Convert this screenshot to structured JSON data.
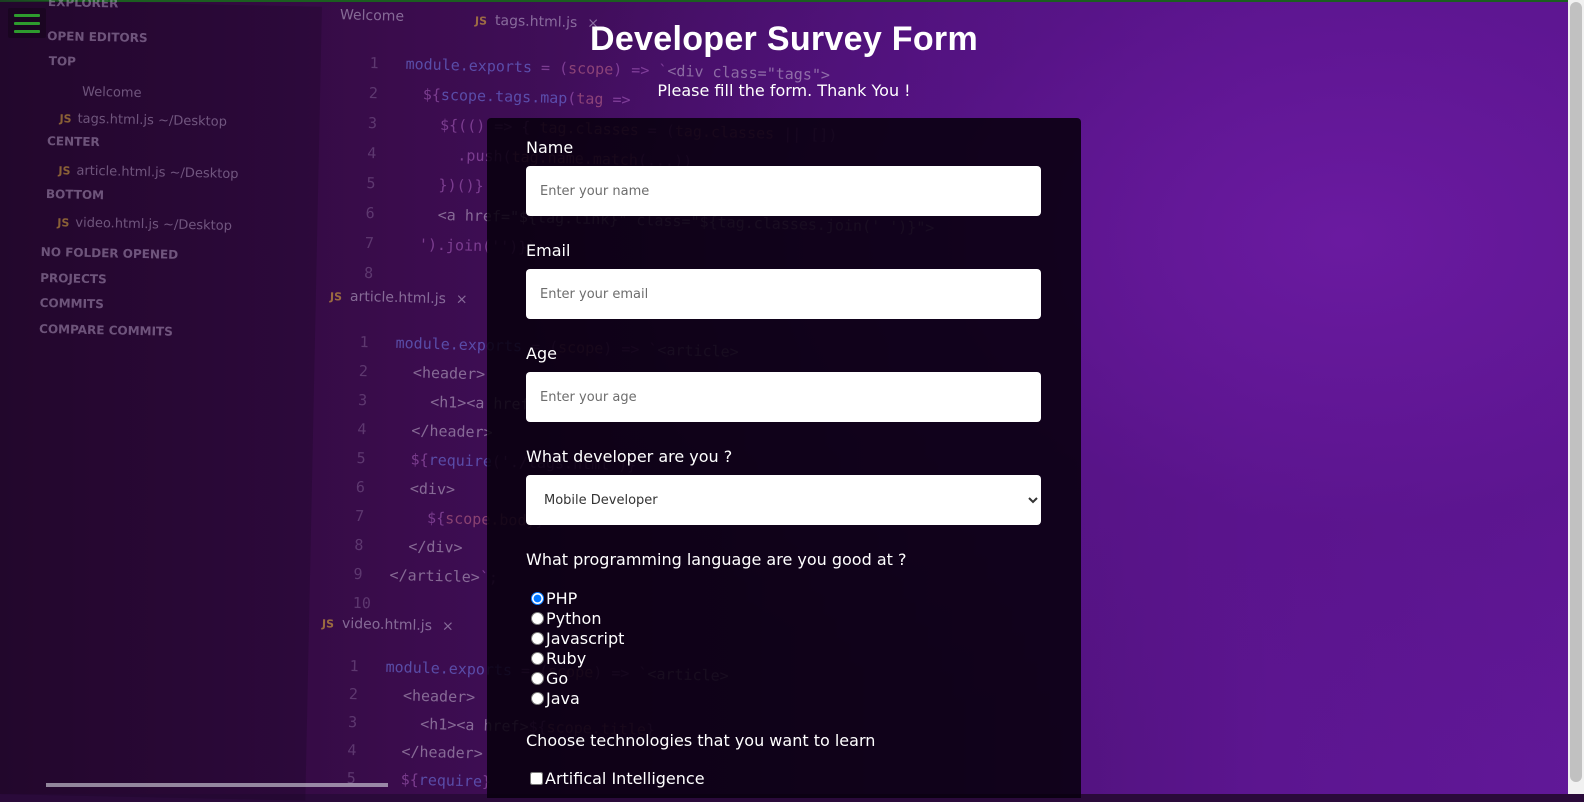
{
  "page": {
    "title": "Developer Survey Form",
    "subtitle": "Please fill the form. Thank You !"
  },
  "background": {
    "sidebar": {
      "explorer": "EXPLORER",
      "open_editors": "OPEN EDITORS",
      "top": "TOP",
      "welcome": "Welcome",
      "tags_file": "tags.html.js",
      "tags_path": "~/Desktop",
      "center": "CENTER",
      "article_file": "article.html.js",
      "article_path": "~/Desktop",
      "bottom": "BOTTOM",
      "video_file": "video.html.js",
      "video_path": "~/Desktop",
      "no_folder": "NO FOLDER OPENED",
      "projects": "PROJECTS",
      "commits": "COMMITS",
      "compare_commits": "COMPARE COMMITS",
      "js_tag": "JS"
    },
    "tabs": {
      "welcome": "Welcome",
      "tags": "tags.html.js",
      "article": "article.html.js",
      "video": "video.html.js",
      "close": "×"
    }
  },
  "form": {
    "name": {
      "label": "Name",
      "placeholder": "Enter your name"
    },
    "email": {
      "label": "Email",
      "placeholder": "Enter your email"
    },
    "age": {
      "label": "Age",
      "placeholder": "Enter your age"
    },
    "developer": {
      "label": "What developer are you ?",
      "selected": "Mobile Developer"
    },
    "language": {
      "label": "What programming language are you good at ?",
      "options": [
        "PHP",
        "Python",
        "Javascript",
        "Ruby",
        "Go",
        "Java"
      ],
      "selected": "PHP"
    },
    "technologies": {
      "label": "Choose technologies that you want to learn",
      "options": [
        "Artifical Intelligence"
      ]
    }
  },
  "colors": {
    "hamburger": "#2e9b2e",
    "form_bg": "#08000e",
    "text": "#ffffff"
  },
  "icons": {
    "menu": "hamburger-menu-icon"
  }
}
